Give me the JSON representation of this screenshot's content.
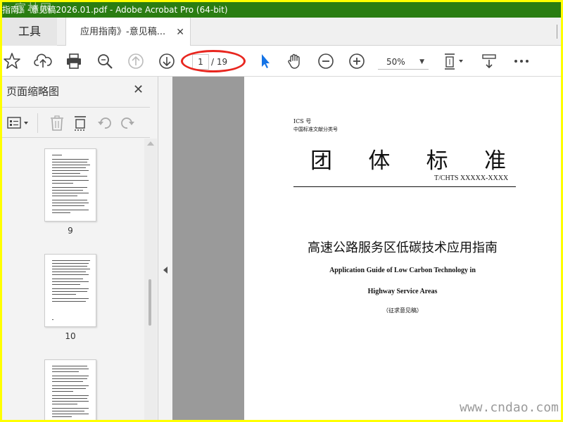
{
  "window": {
    "title": "指南》-意见稿2026.01.pdf - Adobe Acrobat Pro (64-bit)",
    "title_bar_color": "#2a7d12",
    "frame_color": "#ffff00",
    "logo_text": "官林网"
  },
  "tabs": {
    "tools_label": "工具",
    "document_label": "应用指南》-意见稿...",
    "close_glyph": "✕"
  },
  "toolbar": {
    "icons": [
      "star-icon",
      "cloud-upload-icon",
      "print-icon",
      "zoom-search-icon",
      "page-up-icon",
      "page-down-icon",
      "select-cursor-icon",
      "hand-icon",
      "zoom-out-icon",
      "zoom-in-icon",
      "fit-page-icon",
      "more-tools-icon",
      "more-icon"
    ],
    "current_page": "1",
    "total_pages": "/ 19",
    "zoom": "50%",
    "highlight_color": "#e8261f",
    "cursor_color": "#1473e6"
  },
  "sidebar": {
    "title": "页面缩略图",
    "close_glyph": "✕",
    "thumbnails": [
      {
        "label": "9"
      },
      {
        "label": "10"
      },
      {
        "label": ""
      }
    ]
  },
  "document": {
    "ics": "ICS 号",
    "clc": "中国标准文献分类号",
    "heading_chars": [
      "团",
      "体",
      "标",
      "准"
    ],
    "code": "T/CHTS  XXXXX-XXXX",
    "title_cn": "高速公路服务区低碳技术应用指南",
    "title_en_1": "Application Guide of Low Carbon Technology in",
    "title_en_2": "Highway Service Areas",
    "draft_note": "（征求意见稿）"
  },
  "watermark": "www.cndao.com"
}
